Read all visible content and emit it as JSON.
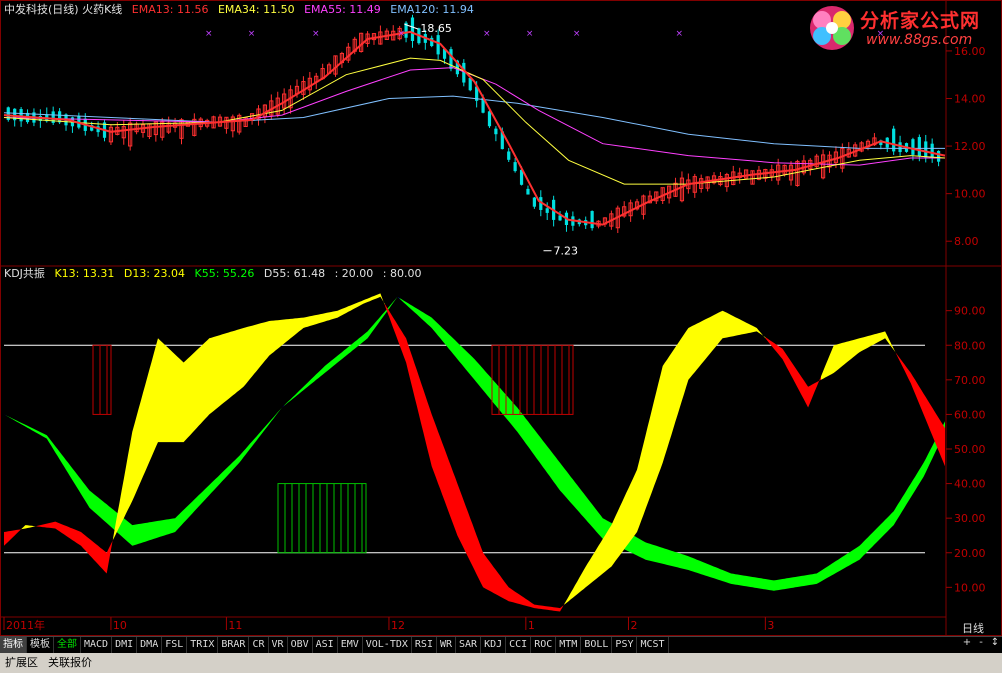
{
  "header_top": {
    "title": "中发科技(日线) 火药K线",
    "ema13": "EMA13: 11.56",
    "ema34": "EMA34: 11.50",
    "ema55": "EMA55: 11.49",
    "ema120": "EMA120: 11.94"
  },
  "header_kdj": {
    "title": "KDJ共振",
    "k13": "K13: 13.31",
    "d13": "D13: 23.04",
    "k55": "K55: 55.26",
    "d55": "D55: 61.48",
    "l20": ": 20.00",
    "l80": ": 80.00"
  },
  "logo": {
    "text": "分析家公式网",
    "url": "www.88gs.com"
  },
  "period_label": "日线",
  "colors": {
    "ema13": "#ff3030",
    "ema34": "#ffff40",
    "ema55": "#ff40ff",
    "ema120": "#80c0ff",
    "up": "#ff3030",
    "down": "#00e0e0",
    "k13": "#ffff00",
    "d13": "#ff0000",
    "k55": "#00ff00",
    "d55": "#0000ff"
  },
  "chart_data": [
    {
      "type": "candlestick",
      "ylim": [
        7,
        17.3
      ],
      "yticks": [
        8,
        10,
        12,
        14,
        16
      ],
      "ytick_labels": [
        "8.00",
        "10.00",
        "12.00",
        "14.00",
        "16.00"
      ],
      "annotations": [
        {
          "text": "18.65",
          "value": 18.65
        },
        {
          "text": "7.23",
          "value": 7.23
        }
      ],
      "series": [
        {
          "name": "EMA13",
          "points": [
            [
              0,
              13.3
            ],
            [
              15,
              13.1
            ],
            [
              25,
              12.6
            ],
            [
              35,
              12.8
            ],
            [
              50,
              13.0
            ],
            [
              58,
              13.1
            ],
            [
              65,
              13.8
            ],
            [
              75,
              14.9
            ],
            [
              85,
              16.5
            ],
            [
              95,
              16.8
            ],
            [
              102,
              16.3
            ],
            [
              110,
              14.7
            ],
            [
              118,
              12.1
            ],
            [
              125,
              9.7
            ],
            [
              132,
              8.9
            ],
            [
              140,
              8.7
            ],
            [
              150,
              9.6
            ],
            [
              160,
              10.4
            ],
            [
              175,
              10.8
            ],
            [
              185,
              11.0
            ],
            [
              195,
              11.5
            ],
            [
              205,
              12.2
            ],
            [
              212,
              11.9
            ],
            [
              220,
              11.6
            ]
          ]
        },
        {
          "name": "EMA34",
          "points": [
            [
              0,
              13.2
            ],
            [
              25,
              12.9
            ],
            [
              50,
              13.0
            ],
            [
              65,
              13.5
            ],
            [
              80,
              15.0
            ],
            [
              95,
              15.7
            ],
            [
              102,
              15.6
            ],
            [
              112,
              14.8
            ],
            [
              122,
              13.0
            ],
            [
              132,
              11.4
            ],
            [
              145,
              10.4
            ],
            [
              160,
              10.4
            ],
            [
              180,
              10.7
            ],
            [
              200,
              11.4
            ],
            [
              212,
              11.6
            ],
            [
              220,
              11.5
            ]
          ]
        },
        {
          "name": "EMA55",
          "points": [
            [
              0,
              13.2
            ],
            [
              50,
              13.0
            ],
            [
              65,
              13.3
            ],
            [
              80,
              14.3
            ],
            [
              95,
              15.2
            ],
            [
              105,
              15.3
            ],
            [
              115,
              14.6
            ],
            [
              125,
              13.5
            ],
            [
              140,
              12.1
            ],
            [
              160,
              11.6
            ],
            [
              180,
              11.3
            ],
            [
              200,
              11.2
            ],
            [
              212,
              11.5
            ],
            [
              220,
              11.5
            ]
          ]
        },
        {
          "name": "EMA120",
          "points": [
            [
              0,
              13.4
            ],
            [
              50,
              13.0
            ],
            [
              70,
              13.2
            ],
            [
              90,
              14.0
            ],
            [
              105,
              14.1
            ],
            [
              120,
              13.8
            ],
            [
              140,
              13.2
            ],
            [
              160,
              12.5
            ],
            [
              180,
              12.1
            ],
            [
              200,
              11.9
            ],
            [
              220,
              11.9
            ]
          ]
        }
      ]
    },
    {
      "type": "area",
      "ylim": [
        2,
        98
      ],
      "yticks": [
        10,
        20,
        30,
        40,
        50,
        60,
        70,
        80,
        90
      ],
      "ytick_labels": [
        "10.00",
        "20.00",
        "30.00",
        "40.00",
        "50.00",
        "60.00",
        "70.00",
        "80.00",
        "90.00"
      ],
      "reference_lines": [
        20,
        80
      ],
      "x_labels": [
        "2011年",
        "10",
        "11",
        "12",
        "1",
        "2",
        "3"
      ],
      "series": [
        {
          "name": "K13",
          "points": [
            [
              0,
              22
            ],
            [
              5,
              28
            ],
            [
              12,
              27
            ],
            [
              18,
              22
            ],
            [
              24,
              14
            ],
            [
              30,
              55
            ],
            [
              36,
              82
            ],
            [
              42,
              75
            ],
            [
              48,
              82
            ],
            [
              56,
              85
            ],
            [
              62,
              87
            ],
            [
              70,
              88
            ],
            [
              78,
              90
            ],
            [
              84,
              93
            ],
            [
              88,
              95
            ],
            [
              94,
              75
            ],
            [
              100,
              45
            ],
            [
              106,
              25
            ],
            [
              112,
              10
            ],
            [
              118,
              6
            ],
            [
              124,
              4
            ],
            [
              130,
              3
            ],
            [
              136,
              16
            ],
            [
              142,
              28
            ],
            [
              148,
              44
            ],
            [
              154,
              74
            ],
            [
              160,
              85
            ],
            [
              168,
              90
            ],
            [
              176,
              85
            ],
            [
              182,
              76
            ],
            [
              188,
              62
            ],
            [
              194,
              80
            ],
            [
              200,
              82
            ],
            [
              206,
              84
            ],
            [
              212,
              69
            ],
            [
              220,
              45
            ]
          ]
        },
        {
          "name": "D13",
          "points": [
            [
              0,
              26
            ],
            [
              5,
              27
            ],
            [
              12,
              29
            ],
            [
              18,
              26
            ],
            [
              24,
              20
            ],
            [
              30,
              35
            ],
            [
              36,
              52
            ],
            [
              42,
              52
            ],
            [
              48,
              60
            ],
            [
              56,
              68
            ],
            [
              62,
              77
            ],
            [
              70,
              85
            ],
            [
              78,
              88
            ],
            [
              84,
              92
            ],
            [
              88,
              94
            ],
            [
              94,
              82
            ],
            [
              100,
              60
            ],
            [
              106,
              40
            ],
            [
              112,
              20
            ],
            [
              118,
              10
            ],
            [
              124,
              5
            ],
            [
              130,
              4
            ],
            [
              136,
              10
            ],
            [
              142,
              16
            ],
            [
              148,
              26
            ],
            [
              154,
              46
            ],
            [
              160,
              70
            ],
            [
              168,
              82
            ],
            [
              176,
              84
            ],
            [
              182,
              79
            ],
            [
              188,
              68
            ],
            [
              194,
              72
            ],
            [
              200,
              78
            ],
            [
              206,
              82
            ],
            [
              212,
              72
            ],
            [
              220,
              56
            ]
          ]
        },
        {
          "name": "K55",
          "points": [
            [
              0,
              60
            ],
            [
              10,
              53
            ],
            [
              20,
              33
            ],
            [
              30,
              22
            ],
            [
              40,
              26
            ],
            [
              55,
              46
            ],
            [
              65,
              62
            ],
            [
              75,
              72
            ],
            [
              85,
              82
            ],
            [
              92,
              94
            ],
            [
              100,
              85
            ],
            [
              110,
              70
            ],
            [
              120,
              55
            ],
            [
              130,
              38
            ],
            [
              140,
              24
            ],
            [
              150,
              18
            ],
            [
              160,
              15
            ],
            [
              170,
              11
            ],
            [
              180,
              9
            ],
            [
              190,
              11
            ],
            [
              200,
              18
            ],
            [
              208,
              28
            ],
            [
              215,
              42
            ],
            [
              220,
              55
            ]
          ]
        },
        {
          "name": "D55",
          "points": [
            [
              0,
              60
            ],
            [
              10,
              54
            ],
            [
              20,
              38
            ],
            [
              30,
              28
            ],
            [
              40,
              30
            ],
            [
              55,
              48
            ],
            [
              65,
              62
            ],
            [
              75,
              74
            ],
            [
              85,
              84
            ],
            [
              92,
              94
            ],
            [
              100,
              88
            ],
            [
              110,
              76
            ],
            [
              120,
              62
            ],
            [
              130,
              46
            ],
            [
              140,
              30
            ],
            [
              150,
              23
            ],
            [
              160,
              19
            ],
            [
              170,
              14
            ],
            [
              180,
              12
            ],
            [
              190,
              14
            ],
            [
              200,
              22
            ],
            [
              208,
              32
            ],
            [
              215,
              46
            ],
            [
              220,
              58
            ]
          ]
        }
      ]
    }
  ]
}
